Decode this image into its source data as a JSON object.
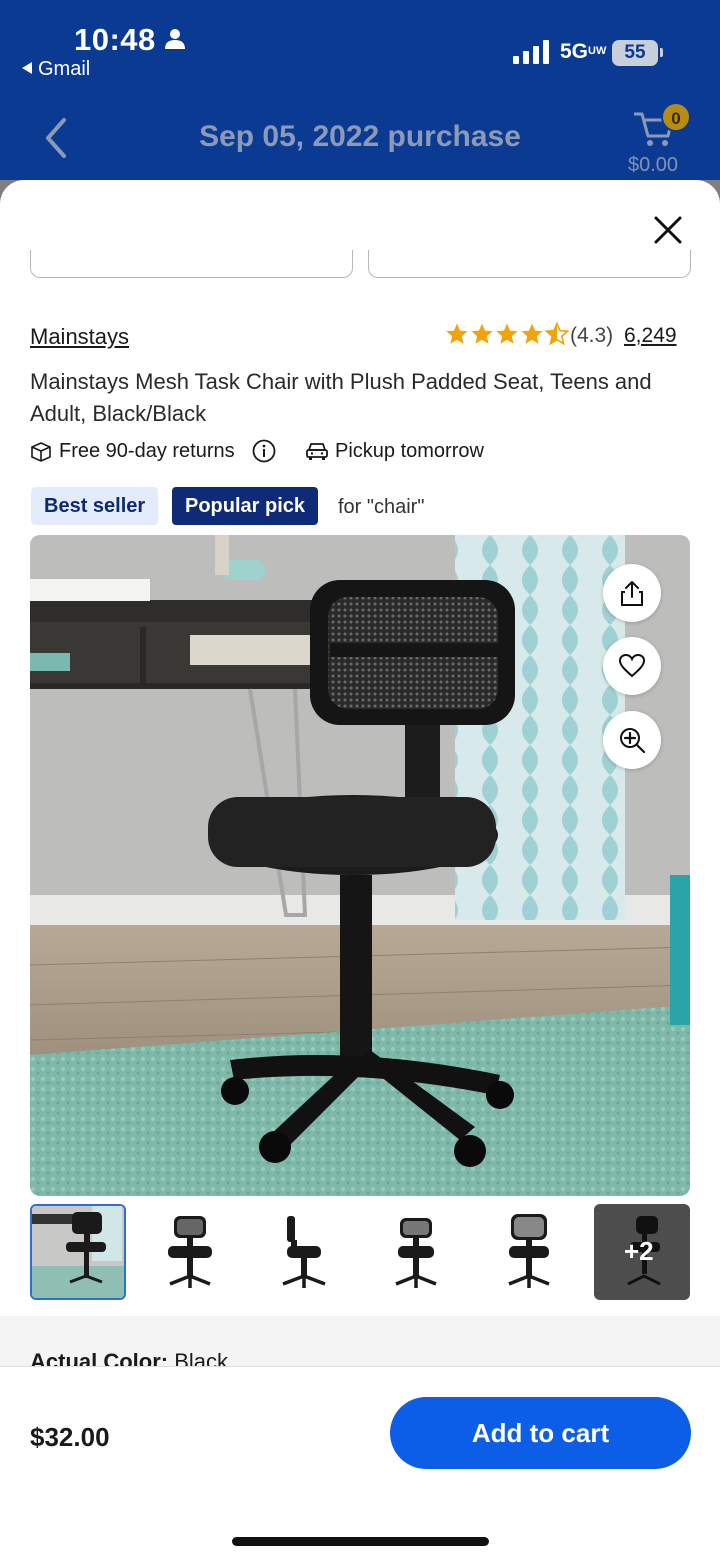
{
  "status_bar": {
    "time": "10:48",
    "back_app": "Gmail",
    "network": "5G",
    "network_superscript": "UW",
    "battery": "55"
  },
  "nav": {
    "title": "Sep 05, 2022 purchase",
    "cart_count": "0",
    "cart_total": "$0.00"
  },
  "product": {
    "brand": "Mainstays",
    "rating": "(4.3)",
    "rating_value": 4.3,
    "review_count": "6,249",
    "title": "Mainstays Mesh Task Chair with Plush Padded Seat, Teens and Adult, Black/Black",
    "returns": "Free 90-day returns",
    "pickup": "Pickup tomorrow",
    "badges": {
      "best_seller": "Best seller",
      "popular_pick": "Popular pick",
      "note": "for \"chair\""
    },
    "more_images": "+2",
    "color_label": "Actual Color:",
    "color_value": "Black"
  },
  "footer": {
    "price": "$32.00",
    "add_to_cart": "Add to cart"
  },
  "colors": {
    "brand_blue": "#0b3a93",
    "button_blue": "#0d5ee6",
    "star": "#f0a30a",
    "popular_pick_bg": "#0f2a77",
    "best_seller_bg": "#e4ecfb"
  }
}
